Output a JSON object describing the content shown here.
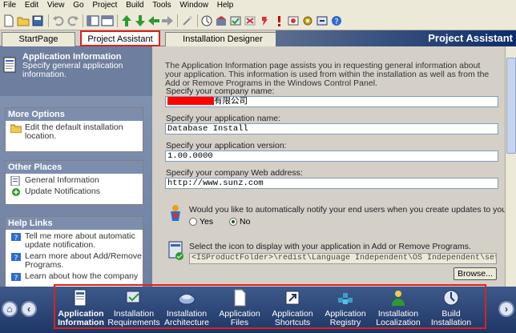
{
  "menu": [
    "File",
    "Edit",
    "View",
    "Go",
    "Project",
    "Build",
    "Tools",
    "Window",
    "Help"
  ],
  "tabs": {
    "start": "StartPage",
    "assistant": "Project Assistant",
    "designer": "Installation Designer",
    "view_title": "Project Assistant"
  },
  "sidebar": {
    "title": "Application Information",
    "description": "Specify general application information.",
    "more_options": {
      "title": "More Options",
      "items": [
        "Edit the default installation location."
      ]
    },
    "other_places": {
      "title": "Other Places",
      "items": [
        "General Information",
        "Update Notifications"
      ]
    },
    "help_links": {
      "title": "Help Links",
      "items": [
        "Tell me more about automatic update notification.",
        "Learn more about Add/Remove Programs.",
        "Learn about how the company"
      ]
    }
  },
  "content": {
    "intro": "The Application Information page assists you in requesting general information about your application. This information is used from within the installation as well as from the Add or Remove Programs in the Windows Control Panel.",
    "company_label": "Specify your company name:",
    "company_value_suffix": "有限公司",
    "app_name_label": "Specify your application name:",
    "app_name_value": "Database Install",
    "version_label": "Specify your application version:",
    "version_value": "1.00.0000",
    "web_label": "Specify your company Web address:",
    "web_value": "http://www.sunz.com",
    "notify_question": "Would you like to automatically notify your end users when you create updates to your",
    "yes_label": "Yes",
    "no_label": "No",
    "icon_label": "Select the icon to display with your application in Add or Remove Programs.",
    "icon_path": "<ISProductFolder>\\redist\\Language Independent\\OS Independent\\setupicon.ico",
    "browse_label": "Browse..."
  },
  "steps": [
    {
      "line1": "Application",
      "line2": "Information"
    },
    {
      "line1": "Installation",
      "line2": "Requirements"
    },
    {
      "line1": "Installation",
      "line2": "Architecture"
    },
    {
      "line1": "Application",
      "line2": "Files"
    },
    {
      "line1": "Application",
      "line2": "Shortcuts"
    },
    {
      "line1": "Application",
      "line2": "Registry"
    },
    {
      "line1": "Installation",
      "line2": "Localization"
    },
    {
      "line1": "Build",
      "line2": "Installation"
    }
  ],
  "colors": {
    "highlight": "#e0201c",
    "sidebar": "#7c8dae",
    "bottombar": "#1d3766"
  }
}
